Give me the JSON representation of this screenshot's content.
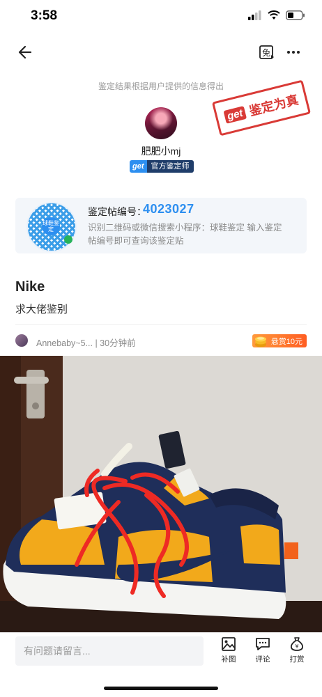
{
  "status": {
    "time": "3:58"
  },
  "disclaimer": "鉴定结果根据用户提供的信息得出",
  "stamp": {
    "brand": "get",
    "text": "鉴定为真"
  },
  "author": {
    "name": "肥肥小mj",
    "badge_brand": "get",
    "badge_text": "官方鉴定师"
  },
  "info_card": {
    "qr_center": "球鞋鉴定",
    "post_id_label": "鉴定帖编号：",
    "post_id": "4023027",
    "description": "识别二维码或微信搜索小程序：球鞋鉴定 输入鉴定帖编号即可查询该鉴定贴"
  },
  "post": {
    "title": "Nike",
    "subtitle": "求大佬鉴别",
    "user": "Annebaby~5... | 30分钟前",
    "reward": "悬赏10元"
  },
  "bottom_bar": {
    "placeholder": "有问题请留言...",
    "actions": [
      {
        "label": "补图",
        "icon": "image-icon"
      },
      {
        "label": "评论",
        "icon": "comment-icon"
      },
      {
        "label": "打赏",
        "icon": "moneybag-icon"
      }
    ]
  },
  "colors": {
    "accent": "#2d8ff0",
    "stamp_red": "#d93a36",
    "reward_orange": "#ff7a2e",
    "sneaker_navy": "#1f2e5a",
    "sneaker_yellow": "#f2a91b",
    "lace_red": "#ee2a24"
  }
}
